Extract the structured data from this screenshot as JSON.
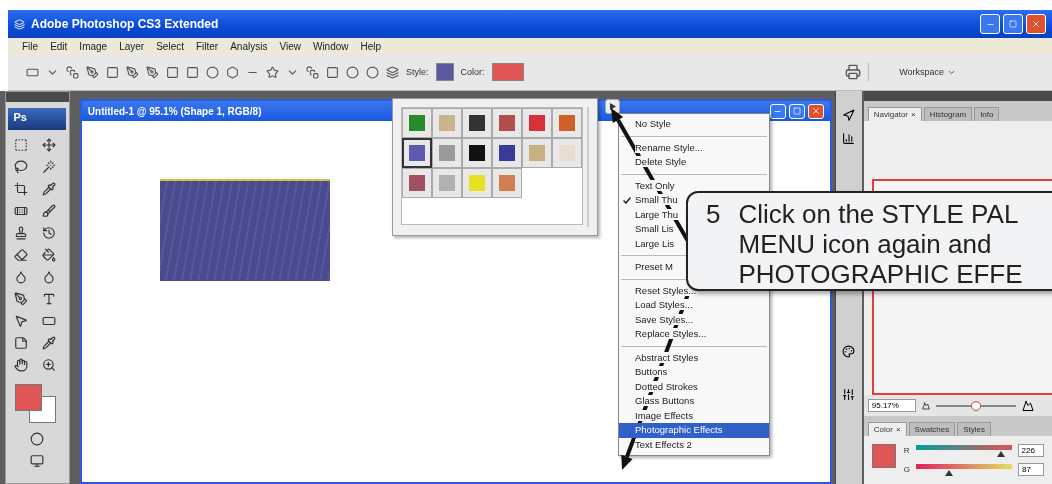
{
  "window": {
    "title": "Adobe Photoshop CS3 Extended"
  },
  "menu_bar": [
    "File",
    "Edit",
    "Image",
    "Layer",
    "Select",
    "Filter",
    "Analysis",
    "View",
    "Window",
    "Help"
  ],
  "options_bar": {
    "style_label": "Style:",
    "color_label": "Color:",
    "workspace": "Workspace"
  },
  "toolbox": {
    "logo": "Ps"
  },
  "document": {
    "title": "Untitled-1 @ 95.1% (Shape 1, RGB/8)"
  },
  "style_picker": {
    "swatches": [
      {
        "color": "#2a8a2a",
        "selected": false
      },
      {
        "color": "#c8b48a",
        "selected": false
      },
      {
        "color": "#333333",
        "selected": false
      },
      {
        "color": "#b0504a",
        "selected": false
      },
      {
        "color": "#d8303a",
        "selected": false
      },
      {
        "color": "#d0602a",
        "selected": false
      },
      {
        "color": "#5a5ab0",
        "selected": true
      },
      {
        "color": "#9a9a9a",
        "selected": false
      },
      {
        "color": "#111111",
        "selected": false
      },
      {
        "color": "#3a3a9a",
        "selected": false
      },
      {
        "color": "#c8b080",
        "selected": false
      },
      {
        "color": "#e8ddd0",
        "selected": false
      },
      {
        "color": "#a05060",
        "selected": false
      },
      {
        "color": "#b0b0b0",
        "selected": false
      },
      {
        "color": "#e8e020",
        "selected": false
      },
      {
        "color": "#d08050",
        "selected": false
      }
    ]
  },
  "style_menu": [
    {
      "kind": "item",
      "label": "No Style",
      "checked": false,
      "selected": false
    },
    {
      "kind": "separator"
    },
    {
      "kind": "item",
      "label": "Rename Style...",
      "checked": false,
      "selected": false
    },
    {
      "kind": "item",
      "label": "Delete Style",
      "checked": false,
      "selected": false
    },
    {
      "kind": "separator"
    },
    {
      "kind": "item",
      "label": "Text Only",
      "checked": false,
      "selected": false
    },
    {
      "kind": "item",
      "label": "Small Thu",
      "checked": true,
      "selected": false
    },
    {
      "kind": "item",
      "label": "Large Thu",
      "checked": false,
      "selected": false
    },
    {
      "kind": "item",
      "label": "Small Lis",
      "checked": false,
      "selected": false
    },
    {
      "kind": "item",
      "label": "Large Lis",
      "checked": false,
      "selected": false
    },
    {
      "kind": "separator"
    },
    {
      "kind": "item",
      "label": "Preset M",
      "checked": false,
      "selected": false
    },
    {
      "kind": "separator"
    },
    {
      "kind": "item",
      "label": "Reset Styles...",
      "checked": false,
      "selected": false
    },
    {
      "kind": "item",
      "label": "Load Styles...",
      "checked": false,
      "selected": false
    },
    {
      "kind": "item",
      "label": "Save Styles...",
      "checked": false,
      "selected": false
    },
    {
      "kind": "item",
      "label": "Replace Styles...",
      "checked": false,
      "selected": false
    },
    {
      "kind": "separator"
    },
    {
      "kind": "item",
      "label": "Abstract Styles",
      "checked": false,
      "selected": false
    },
    {
      "kind": "item",
      "label": "Buttons",
      "checked": false,
      "selected": false
    },
    {
      "kind": "item",
      "label": "Dotted Strokes",
      "checked": false,
      "selected": false
    },
    {
      "kind": "item",
      "label": "Glass Buttons",
      "checked": false,
      "selected": false
    },
    {
      "kind": "item",
      "label": "Image Effects",
      "checked": false,
      "selected": false
    },
    {
      "kind": "item",
      "label": "Photographic Effects",
      "checked": false,
      "selected": true
    },
    {
      "kind": "item",
      "label": "Text Effects 2",
      "checked": false,
      "selected": false
    }
  ],
  "navigator_panel": {
    "tabs": [
      {
        "label": "Navigator",
        "close": "×",
        "selected": true
      },
      {
        "label": "Histogram",
        "selected": false
      },
      {
        "label": "Info",
        "selected": false
      }
    ],
    "zoom": "95.17%",
    "level": 0.5
  },
  "color_panel": {
    "tabs": [
      {
        "label": "Color",
        "close": "×",
        "selected": true
      },
      {
        "label": "Swatches",
        "selected": false
      },
      {
        "label": "Styles",
        "selected": false
      }
    ],
    "channels": [
      {
        "name": "R",
        "value": "226",
        "level": 0.89
      },
      {
        "name": "G",
        "value": "87",
        "level": 0.34
      }
    ]
  },
  "callout": {
    "number": "5",
    "lines": [
      "Click on the STYLE PAL",
      "MENU icon again and",
      "PHOTOGRAPHIC EFFE"
    ]
  }
}
